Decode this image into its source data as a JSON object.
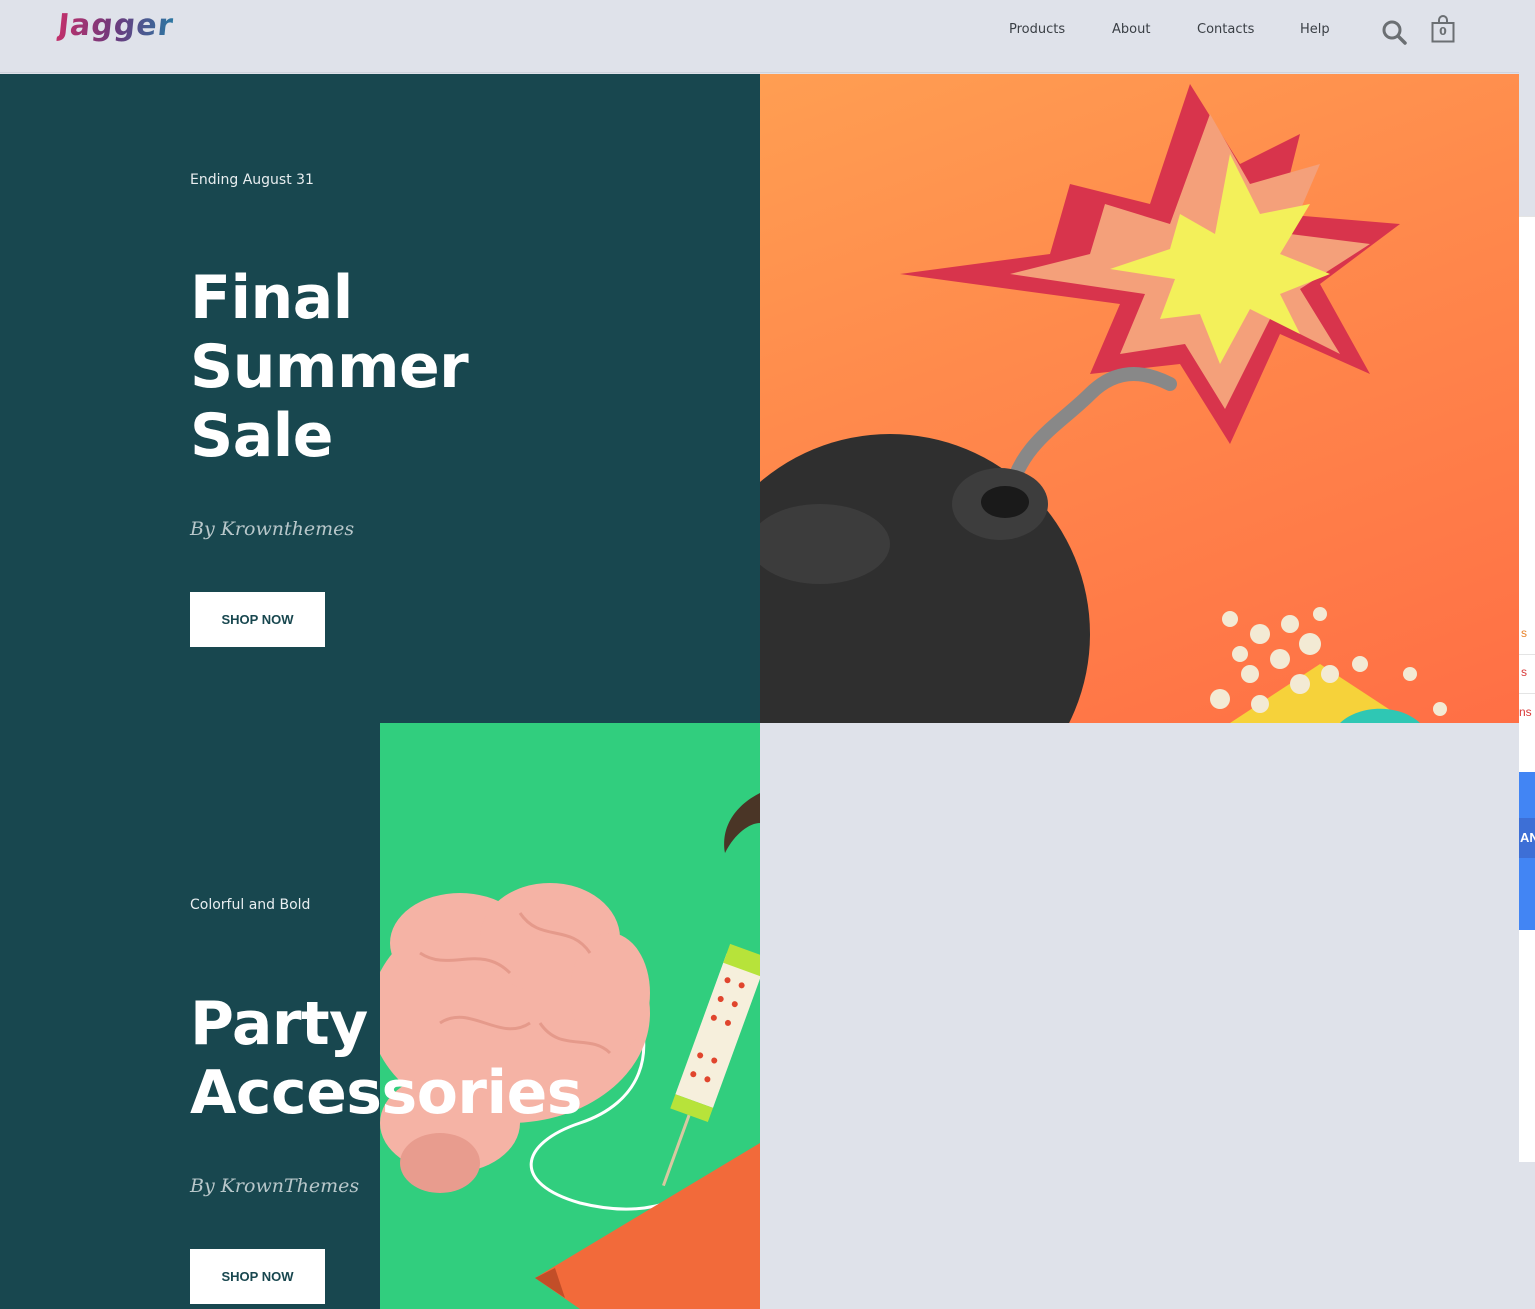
{
  "header": {
    "logo": "Jagger",
    "nav": [
      {
        "label": "Products"
      },
      {
        "label": "About"
      },
      {
        "label": "Contacts"
      },
      {
        "label": "Help"
      }
    ],
    "search_icon": "search-icon",
    "cart_icon": "shopping-bag-icon",
    "cart_count": "0"
  },
  "hero1": {
    "eyebrow": "Ending August 31",
    "title_lines": [
      "Final",
      "Summer",
      "Sale"
    ],
    "byline": "By Krownthemes",
    "button": "SHOP NOW",
    "image": "bomb-with-explosion-and-popcorn"
  },
  "hero2": {
    "eyebrow": "Colorful and Bold",
    "title_lines": [
      "Party",
      "Accessories"
    ],
    "byline": "By KrownThemes",
    "button": "SHOP NOW",
    "image": "brain-balloon-party-horn"
  },
  "edge_panel": {
    "fragments": [
      "s",
      "s",
      "ns"
    ],
    "fragment_colors": [
      "#e8832a",
      "#d93a3a",
      "#d93a3a"
    ],
    "button_fragment": "AN",
    "button_color": "#4285f4"
  },
  "colors": {
    "header_bg": "#dfe2ea",
    "dark_teal": "#18474f",
    "orange": "#ff7a4a",
    "green": "#31ce7e"
  }
}
